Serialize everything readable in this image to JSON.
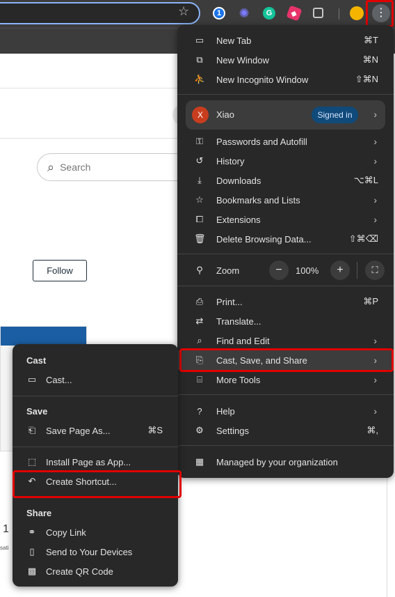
{
  "page": {
    "search_placeholder": "Search",
    "follow_label": "Follow",
    "page_number": "1",
    "small_text": "sati"
  },
  "toolbar": {
    "star_icon": "star-icon",
    "menu_glyph": "⋮"
  },
  "menu": {
    "new_tab": {
      "label": "New Tab",
      "shortcut": "⌘T"
    },
    "new_window": {
      "label": "New Window",
      "shortcut": "⌘N"
    },
    "new_incognito": {
      "label": "New Incognito Window",
      "shortcut": "⇧⌘N"
    },
    "profile": {
      "initial": "X",
      "name": "Xiao",
      "badge": "Signed in"
    },
    "passwords": {
      "label": "Passwords and Autofill"
    },
    "history": {
      "label": "History"
    },
    "downloads": {
      "label": "Downloads",
      "shortcut": "⌥⌘L"
    },
    "bookmarks": {
      "label": "Bookmarks and Lists"
    },
    "extensions": {
      "label": "Extensions"
    },
    "delete_data": {
      "label": "Delete Browsing Data...",
      "shortcut": "⇧⌘⌫"
    },
    "zoom": {
      "label": "Zoom",
      "minus": "−",
      "value": "100%",
      "plus": "+"
    },
    "print": {
      "label": "Print...",
      "shortcut": "⌘P"
    },
    "translate": {
      "label": "Translate..."
    },
    "find_edit": {
      "label": "Find and Edit"
    },
    "cast_save_share": {
      "label": "Cast, Save, and Share"
    },
    "more_tools": {
      "label": "More Tools"
    },
    "help": {
      "label": "Help"
    },
    "settings": {
      "label": "Settings",
      "shortcut": "⌘,"
    },
    "managed": {
      "label": "Managed by your organization"
    }
  },
  "submenu": {
    "cast_header": "Cast",
    "cast_item": "Cast...",
    "save_header": "Save",
    "save_page_as": {
      "label": "Save Page As...",
      "shortcut": "⌘S"
    },
    "install_app": "Install Page as App...",
    "create_shortcut": "Create Shortcut...",
    "share_header": "Share",
    "copy_link": "Copy Link",
    "send_devices": "Send to Your Devices",
    "create_qr": "Create QR Code"
  },
  "colors": {
    "highlight": "#e00000",
    "menu_bg": "#282828",
    "signed_in_pill": "#0f4a7a"
  }
}
